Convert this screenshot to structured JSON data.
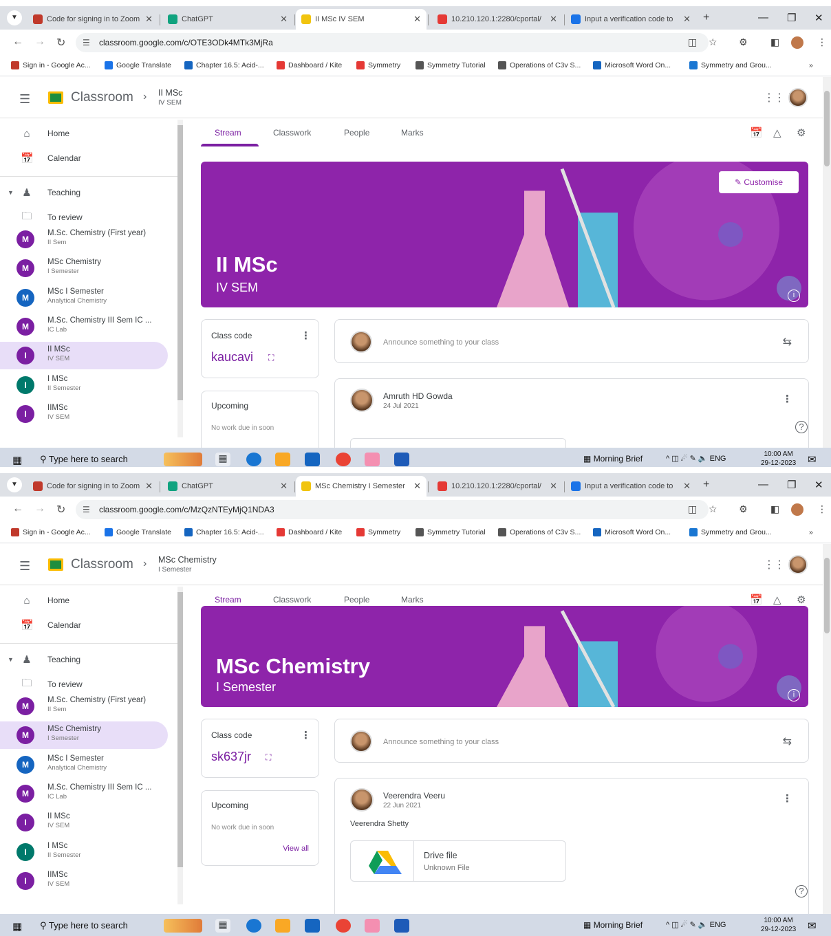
{
  "shots": [
    {
      "tabs": [
        {
          "title": "Code for signing in to Zoom",
          "color": "#c0392b"
        },
        {
          "title": "ChatGPT",
          "color": "#10a37f"
        },
        {
          "title": "II MSc IV SEM",
          "color": "#f1c40f",
          "active": true
        },
        {
          "title": "10.210.120.1:2280/cportal/",
          "color": "#e53935"
        },
        {
          "title": "Input a verification code to",
          "color": "#1a73e8"
        }
      ],
      "new_tab": "+",
      "url": "classroom.google.com/c/OTE3ODk4MTk3MjRa",
      "bookmarks": [
        "Sign in - Google Ac...",
        "Google Translate",
        "Chapter 16.5: Acid-...",
        "Dashboard / Kite",
        "Symmetry",
        "Symmetry Tutorial",
        "Operations of C3v S...",
        "Microsoft Word On...",
        "Symmetry and Grou..."
      ],
      "bookmarks_more": "»",
      "app_name": "Classroom",
      "class_title": "II MSc",
      "class_subtitle": "IV SEM",
      "sidebar": {
        "home": "Home",
        "calendar": "Calendar",
        "teaching": "Teaching",
        "to_review": "To review",
        "classes": [
          {
            "letter": "M",
            "name": "M.Sc. Chemistry (First year)",
            "sub": "II Sem",
            "color": "#7b1fa2"
          },
          {
            "letter": "M",
            "name": "MSc Chemistry",
            "sub": "I Semester",
            "color": "#7b1fa2"
          },
          {
            "letter": "M",
            "name": "MSc I Semester",
            "sub": "Analytical Chemistry",
            "color": "#1565c0"
          },
          {
            "letter": "M",
            "name": "M.Sc. Chemistry III Sem IC ...",
            "sub": "IC Lab",
            "color": "#7b1fa2"
          },
          {
            "letter": "I",
            "name": "II MSc",
            "sub": "IV SEM",
            "color": "#7b1fa2",
            "selected": true
          },
          {
            "letter": "I",
            "name": "I MSc",
            "sub": "II Semester",
            "color": "#00796b"
          },
          {
            "letter": "I",
            "name": "IIMSc",
            "sub": "IV SEM",
            "color": "#7b1fa2"
          }
        ]
      },
      "class_tabs": [
        "Stream",
        "Classwork",
        "People",
        "Marks"
      ],
      "banner": {
        "title": "II MSc",
        "subtitle": "IV SEM",
        "customise": "Customise"
      },
      "class_code": {
        "label": "Class code",
        "value": "kaucavi"
      },
      "upcoming": {
        "label": "Upcoming",
        "text": "No work due in soon",
        "view_all": ""
      },
      "announce": "Announce something to your class",
      "post": {
        "author": "Amruth HD Gowda",
        "date": "24 Jul 2021",
        "text": "",
        "file_name": "",
        "file_type": ""
      },
      "taskbar": {
        "search": "Type here to search",
        "brief": "Morning Brief",
        "lang": "ENG",
        "time": "10:00 AM",
        "date": "29-12-2023"
      }
    },
    {
      "tabs": [
        {
          "title": "Code for signing in to Zoom",
          "color": "#c0392b"
        },
        {
          "title": "ChatGPT",
          "color": "#10a37f"
        },
        {
          "title": "MSc Chemistry I Semester",
          "color": "#f1c40f",
          "active": true
        },
        {
          "title": "10.210.120.1:2280/cportal/",
          "color": "#e53935"
        },
        {
          "title": "Input a verification code to",
          "color": "#1a73e8"
        }
      ],
      "new_tab": "+",
      "url": "classroom.google.com/c/MzQzNTEyMjQ1NDA3",
      "bookmarks": [
        "Sign in - Google Ac...",
        "Google Translate",
        "Chapter 16.5: Acid-...",
        "Dashboard / Kite",
        "Symmetry",
        "Symmetry Tutorial",
        "Operations of C3v S...",
        "Microsoft Word On...",
        "Symmetry and Grou..."
      ],
      "bookmarks_more": "»",
      "app_name": "Classroom",
      "class_title": "MSc Chemistry",
      "class_subtitle": "I Semester",
      "sidebar": {
        "home": "Home",
        "calendar": "Calendar",
        "teaching": "Teaching",
        "to_review": "To review",
        "classes": [
          {
            "letter": "M",
            "name": "M.Sc. Chemistry (First year)",
            "sub": "II Sem",
            "color": "#7b1fa2"
          },
          {
            "letter": "M",
            "name": "MSc Chemistry",
            "sub": "I Semester",
            "color": "#7b1fa2",
            "selected": true
          },
          {
            "letter": "M",
            "name": "MSc I Semester",
            "sub": "Analytical Chemistry",
            "color": "#1565c0"
          },
          {
            "letter": "M",
            "name": "M.Sc. Chemistry III Sem IC ...",
            "sub": "IC Lab",
            "color": "#7b1fa2"
          },
          {
            "letter": "I",
            "name": "II MSc",
            "sub": "IV SEM",
            "color": "#7b1fa2"
          },
          {
            "letter": "I",
            "name": "I MSc",
            "sub": "II Semester",
            "color": "#00796b"
          },
          {
            "letter": "I",
            "name": "IIMSc",
            "sub": "IV SEM",
            "color": "#7b1fa2"
          }
        ]
      },
      "class_tabs": [
        "Stream",
        "Classwork",
        "People",
        "Marks"
      ],
      "banner": {
        "title": "MSc Chemistry",
        "subtitle": "I Semester",
        "customise": ""
      },
      "class_code": {
        "label": "Class code",
        "value": "sk637jr"
      },
      "upcoming": {
        "label": "Upcoming",
        "text": "No work due in soon",
        "view_all": "View all"
      },
      "announce": "Announce something to your class",
      "post": {
        "author": "Veerendra Veeru",
        "date": "22 Jun 2021",
        "text": "Veerendra Shetty",
        "file_name": "Drive file",
        "file_type": "Unknown File"
      },
      "taskbar": {
        "search": "Type here to search",
        "brief": "Morning Brief",
        "lang": "ENG",
        "time": "10:00 AM",
        "date": "29-12-2023"
      }
    }
  ]
}
